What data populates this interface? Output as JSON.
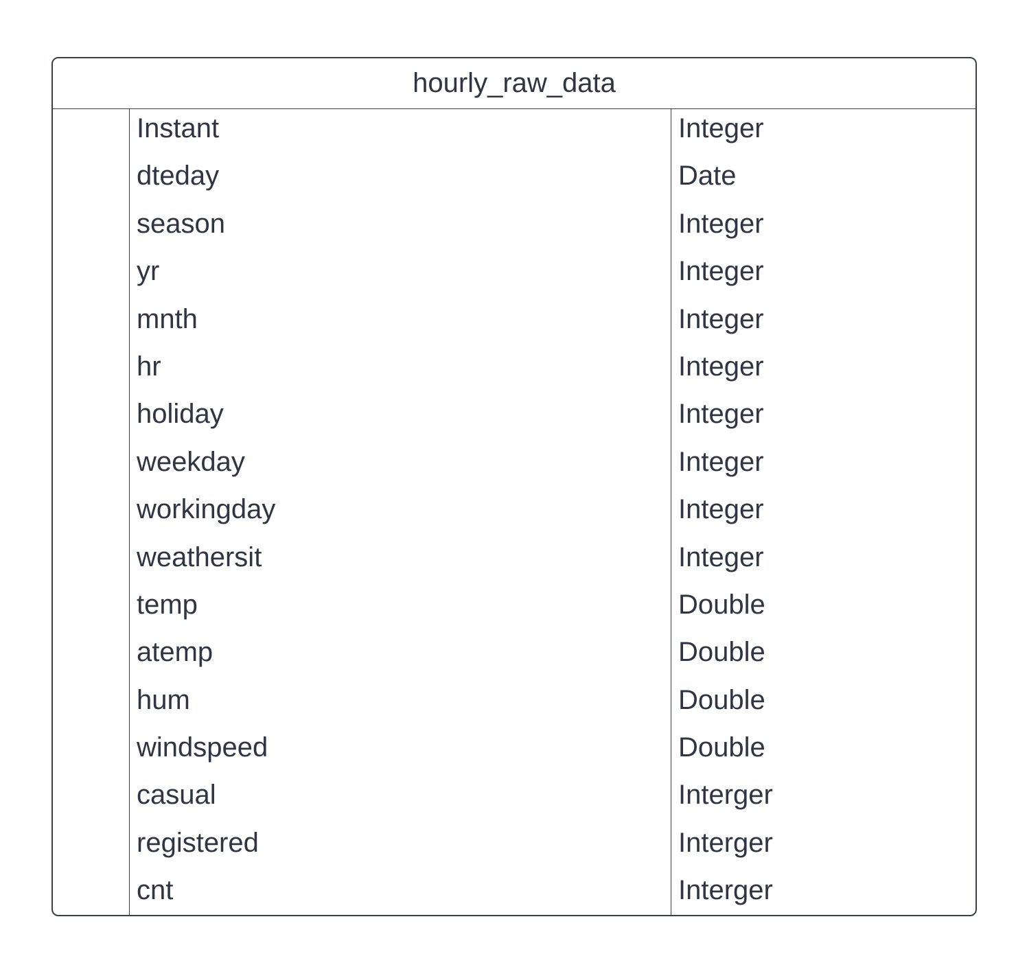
{
  "entity": {
    "title": "hourly_raw_data",
    "fields": [
      {
        "name": "Instant",
        "type": "Integer"
      },
      {
        "name": "dteday",
        "type": "Date"
      },
      {
        "name": "season",
        "type": "Integer"
      },
      {
        "name": "yr",
        "type": "Integer"
      },
      {
        "name": "mnth",
        "type": "Integer"
      },
      {
        "name": "hr",
        "type": "Integer"
      },
      {
        "name": "holiday",
        "type": "Integer"
      },
      {
        "name": "weekday",
        "type": "Integer"
      },
      {
        "name": "workingday",
        "type": "Integer"
      },
      {
        "name": "weathersit",
        "type": "Integer"
      },
      {
        "name": "temp",
        "type": "Double"
      },
      {
        "name": "atemp",
        "type": "Double"
      },
      {
        "name": "hum",
        "type": "Double"
      },
      {
        "name": "windspeed",
        "type": "Double"
      },
      {
        "name": "casual",
        "type": "Interger"
      },
      {
        "name": "registered",
        "type": "Interger"
      },
      {
        "name": "cnt",
        "type": "Interger"
      }
    ]
  }
}
